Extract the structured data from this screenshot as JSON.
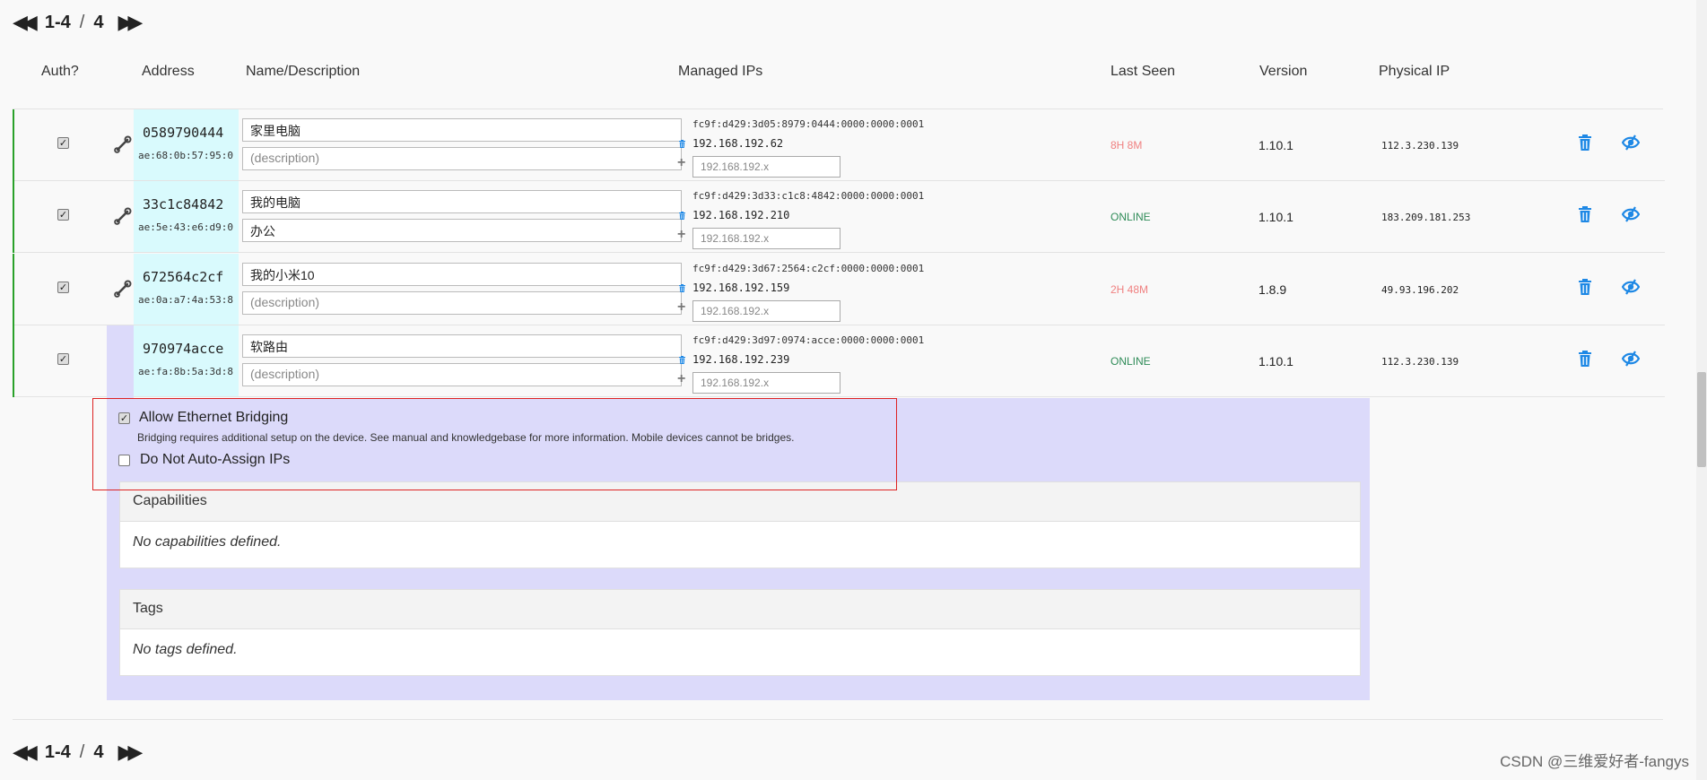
{
  "pager": {
    "range": "1-4",
    "separator": "/",
    "total": "4"
  },
  "columns": {
    "auth": "Auth?",
    "address": "Address",
    "name": "Name/Description",
    "managed_ips": "Managed IPs",
    "last_seen": "Last Seen",
    "version": "Version",
    "physical_ip": "Physical IP"
  },
  "ip_placeholder": "192.168.192.x",
  "desc_placeholder": "(description)",
  "colors": {
    "row_border": "#2aa12a",
    "online": "#2e8b57",
    "offline": "#f08080",
    "accent": "#1e88e5",
    "addr_bg": "#d9fafd",
    "panel_bg": "#dcdafa"
  },
  "members": [
    {
      "address": "0589790444",
      "mac": "ae:68:0b:57:95:0",
      "name": "家里电脑",
      "description": "",
      "ipv6": "fc9f:d429:3d05:8979:0444:0000:0000:0001",
      "ipv4": "192.168.192.62",
      "last_seen": "8H 8M",
      "status": "offline",
      "version": "1.10.1",
      "physical_ip": "112.3.230.139",
      "authorized": true
    },
    {
      "address": "33c1c84842",
      "mac": "ae:5e:43:e6:d9:0",
      "name": "我的电脑",
      "description": "办公",
      "ipv6": "fc9f:d429:3d33:c1c8:4842:0000:0000:0001",
      "ipv4": "192.168.192.210",
      "last_seen": "ONLINE",
      "status": "online",
      "version": "1.10.1",
      "physical_ip": "183.209.181.253",
      "authorized": true
    },
    {
      "address": "672564c2cf",
      "mac": "ae:0a:a7:4a:53:8",
      "name": "我的小米10",
      "description": "",
      "ipv6": "fc9f:d429:3d67:2564:c2cf:0000:0000:0001",
      "ipv4": "192.168.192.159",
      "last_seen": "2H 48M",
      "status": "offline",
      "version": "1.8.9",
      "physical_ip": "49.93.196.202",
      "authorized": true
    },
    {
      "address": "970974acce",
      "mac": "ae:fa:8b:5a:3d:8",
      "name": "软路由",
      "description": "",
      "ipv6": "fc9f:d429:3d97:0974:acce:0000:0000:0001",
      "ipv4": "192.168.192.239",
      "last_seen": "ONLINE",
      "status": "online",
      "version": "1.10.1",
      "physical_ip": "112.3.230.139",
      "authorized": true
    }
  ],
  "detail": {
    "bridging_label": "Allow Ethernet Bridging",
    "bridging_checked": true,
    "bridging_help": "Bridging requires additional setup on the device. See manual and knowledgebase for more information. Mobile devices cannot be bridges.",
    "no_auto_assign_label": "Do Not Auto-Assign IPs",
    "no_auto_assign_checked": false,
    "capabilities_title": "Capabilities",
    "capabilities_empty": "No capabilities defined.",
    "tags_title": "Tags",
    "tags_empty": "No tags defined."
  },
  "watermark": "CSDN @三维爱好者-fangys"
}
